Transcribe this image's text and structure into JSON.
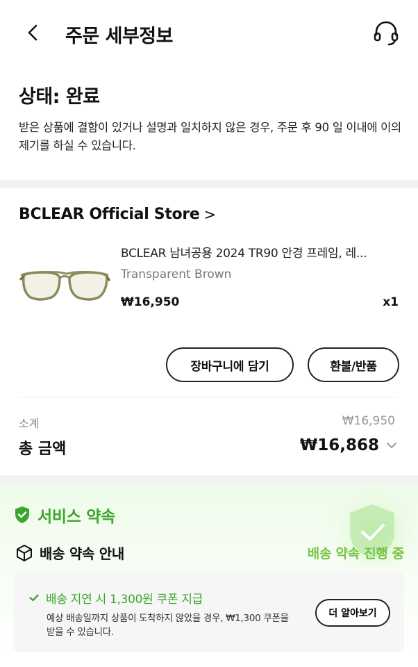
{
  "header": {
    "title": "주문 세부정보"
  },
  "status": {
    "title": "상태: 완료",
    "description": "받은 상품에 결함이 있거나 설명과 일치하지 않은 경우, 주문 후 90 일 이내에 이의 제기를 하실 수 있습니다."
  },
  "store": {
    "name": "BCLEAR Official Store",
    "chevron": ">"
  },
  "product": {
    "title": "BCLEAR 남녀공용 2024 TR90 안경 프레임, 레...",
    "variant": "Transparent Brown",
    "price": "₩16,950",
    "quantity": "x1"
  },
  "actions": {
    "add_to_cart_label": "장바구니에 담기",
    "refund_label": "환불/반품"
  },
  "summary": {
    "subtotal_label": "소계",
    "subtotal_value": "₩16,950",
    "total_label": "총 금액",
    "total_value": "₩16,868"
  },
  "service": {
    "title": "서비스 약속",
    "delivery_label": "배송 약속 안내",
    "delivery_status": "배송 약속 진행 중",
    "promise_title": "배송 지연 시 1,300원 쿠폰 지급",
    "promise_desc": "예상 배송일까지 상품이 도착하지 않았을 경우, ₩1,300 쿠폰을 받을 수 있습니다.",
    "learn_more_label": "더 알아보기"
  },
  "colors": {
    "accent_green": "#3aa72c",
    "status_green": "#78c445"
  }
}
